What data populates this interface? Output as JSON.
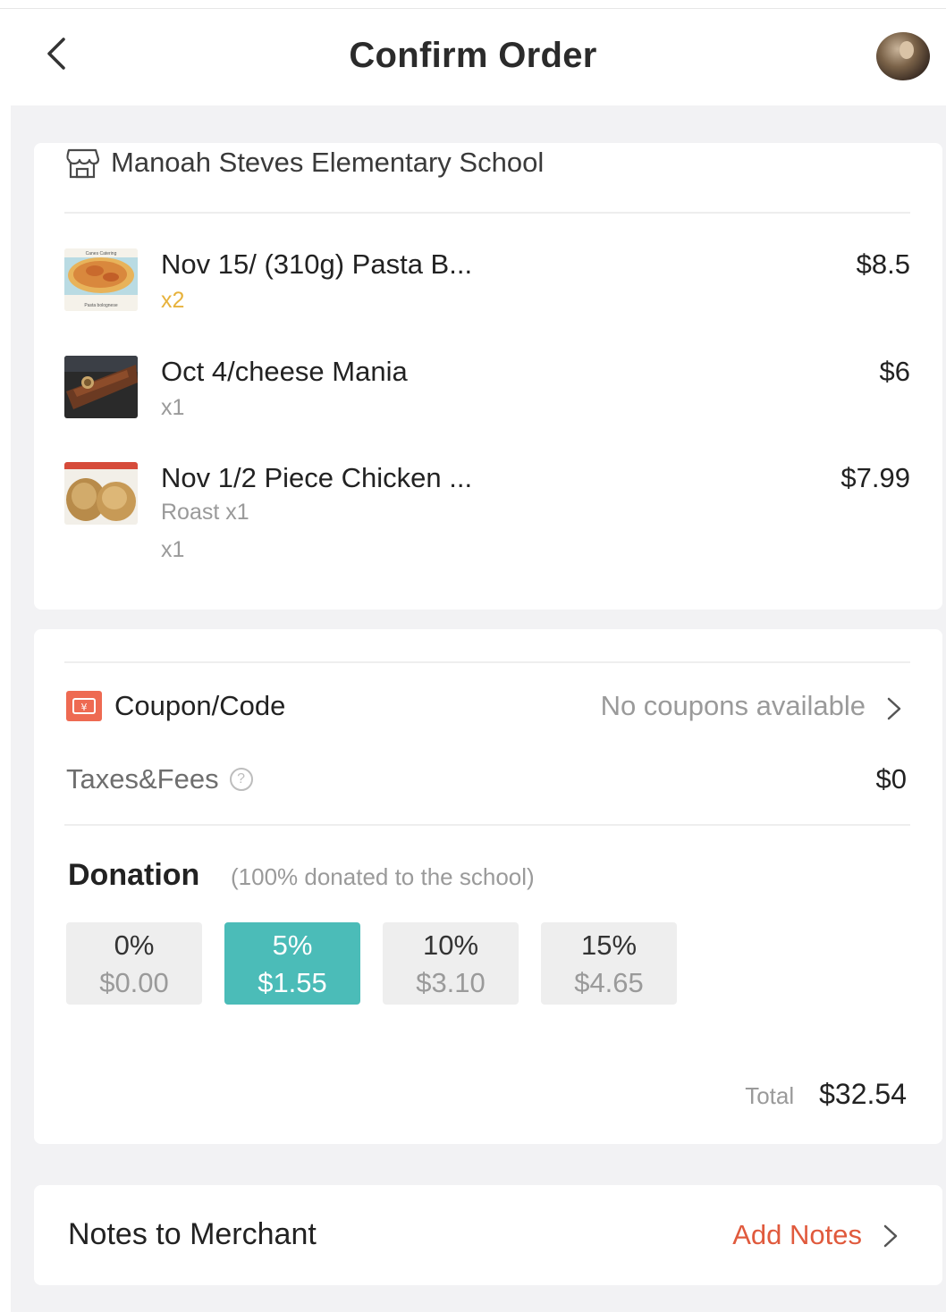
{
  "header": {
    "title": "Confirm Order"
  },
  "merchant": {
    "name": "Manoah Steves Elementary School"
  },
  "items": [
    {
      "name": "Nov 15/ (310g) Pasta B...",
      "option": "",
      "qty": "x2",
      "price": "$8.5",
      "thumb_caption_top": "Canes Catering",
      "thumb_caption_bottom": "Pasta bolognese"
    },
    {
      "name": "Oct 4/cheese Mania",
      "option": "",
      "qty": "x1",
      "price": "$6"
    },
    {
      "name": "Nov 1/2 Piece Chicken ...",
      "option": "Roast x1",
      "qty": "x1",
      "price": "$7.99"
    }
  ],
  "coupon": {
    "label": "Coupon/Code",
    "value": "No coupons available",
    "icon": "coupon-icon"
  },
  "taxes": {
    "label": "Taxes&Fees",
    "help": "?",
    "value": "$0"
  },
  "donation": {
    "title": "Donation",
    "note": "(100% donated to the school)",
    "options": [
      {
        "percent": "0%",
        "amount": "$0.00",
        "selected": false
      },
      {
        "percent": "5%",
        "amount": "$1.55",
        "selected": true
      },
      {
        "percent": "10%",
        "amount": "$3.10",
        "selected": false
      },
      {
        "percent": "15%",
        "amount": "$4.65",
        "selected": false
      }
    ]
  },
  "total": {
    "label": "Total",
    "value": "$32.54"
  },
  "notes": {
    "label": "Notes to Merchant",
    "action": "Add Notes"
  },
  "colors": {
    "accent_teal": "#4bbcb8",
    "action_red": "#e05a3d",
    "coupon_red": "#ee6a52",
    "qty_yellow": "#e7b23c"
  }
}
